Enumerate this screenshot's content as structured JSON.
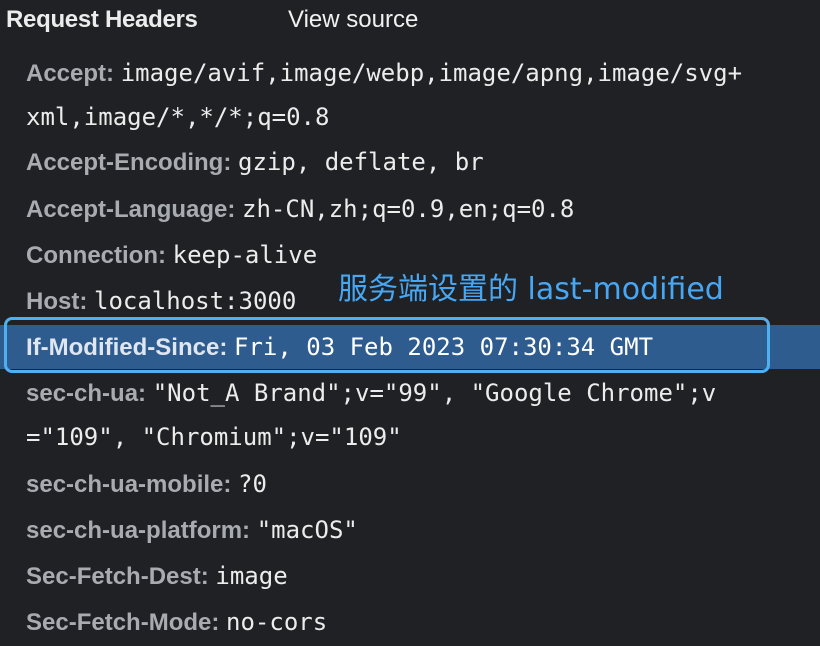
{
  "panel": {
    "title": "Request Headers",
    "view_source": "View source"
  },
  "headers": [
    {
      "name": "Accept:",
      "value": "image/avif,image/webp,image/apng,image/svg+",
      "cont": "xml,image/*,*/*;q=0.8"
    },
    {
      "name": "Accept-Encoding:",
      "value": "gzip, deflate, br"
    },
    {
      "name": "Accept-Language:",
      "value": "zh-CN,zh;q=0.9,en;q=0.8"
    },
    {
      "name": "Connection:",
      "value": "keep-alive"
    },
    {
      "name": "Host:",
      "value": "localhost:3000"
    },
    {
      "name": "If-Modified-Since:",
      "value": "Fri, 03 Feb 2023 07:30:34 GMT"
    },
    {
      "name": "sec-ch-ua:",
      "value": "\"Not_A Brand\";v=\"99\", \"Google Chrome\";v",
      "cont": "=\"109\", \"Chromium\";v=\"109\""
    },
    {
      "name": "sec-ch-ua-mobile:",
      "value": "?0"
    },
    {
      "name": "sec-ch-ua-platform:",
      "value": "\"macOS\""
    },
    {
      "name": "Sec-Fetch-Dest:",
      "value": "image"
    },
    {
      "name": "Sec-Fetch-Mode:",
      "value": "no-cors"
    }
  ],
  "annotation": "服务端设置的 last-modified",
  "colors": {
    "background": "#202124",
    "highlight_band": "#2e5c8f",
    "highlight_border": "#4fb0f0",
    "annotation": "#46a7f5"
  }
}
